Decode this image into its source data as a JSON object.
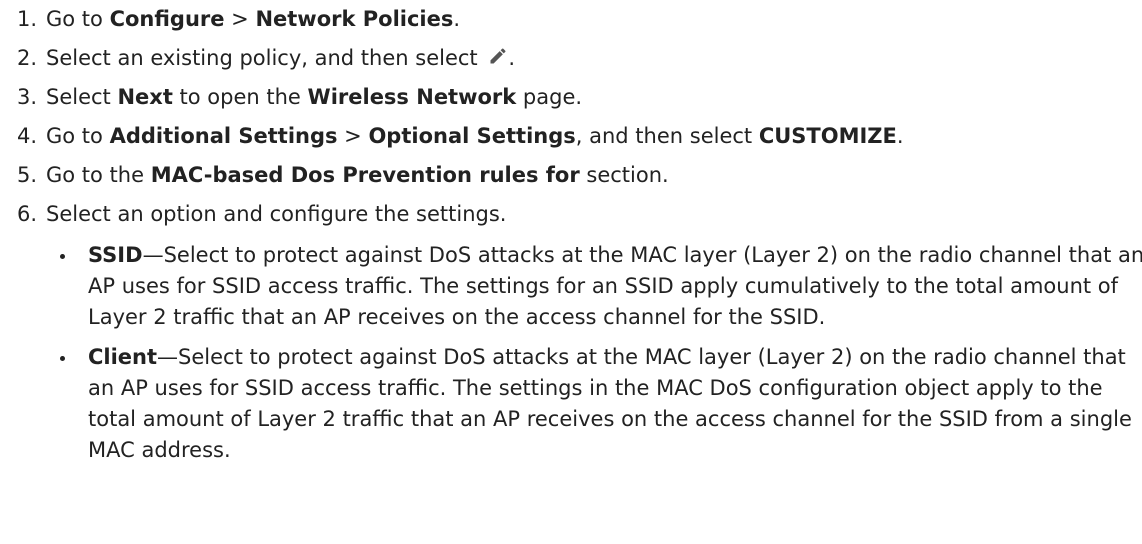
{
  "steps": [
    {
      "num": "1.",
      "t1": "Go to ",
      "b1": "Configure",
      "t2": " > ",
      "b2": "Network Policies",
      "t3": "."
    },
    {
      "num": "2.",
      "t1": "Select an existing policy, and then select ",
      "icon": "pencil-edit-icon",
      "t2": "."
    },
    {
      "num": "3.",
      "t1": "Select ",
      "b1": "Next",
      "t2": " to open the ",
      "b2": "Wireless Network",
      "t3": " page."
    },
    {
      "num": "4.",
      "t1": "Go to ",
      "b1": "Additional Settings",
      "t2": " > ",
      "b2": "Optional Settings",
      "t3": ", and then select ",
      "b3": "CUSTOMIZE",
      "t4": "."
    },
    {
      "num": "5.",
      "t1": "Go to the ",
      "b1": "MAC-based Dos Prevention rules for",
      "t2": " section."
    },
    {
      "num": "6.",
      "t1": "Select an option and configure the settings."
    }
  ],
  "options": [
    {
      "name": "SSID",
      "text": "—Select to protect against DoS attacks at the MAC layer (Layer 2) on the radio channel that an AP uses for SSID access traffic. The settings for an SSID apply cumulatively to the total amount of Layer 2 traffic that an AP receives on the access channel for the SSID."
    },
    {
      "name": "Client",
      "text": "—Select to protect against DoS attacks at the MAC layer (Layer 2) on the radio channel that an AP uses for SSID access traffic. The settings in the MAC DoS configuration object apply to the total amount of Layer 2 traffic that an AP receives on the access channel for the SSID from a single MAC address."
    }
  ]
}
